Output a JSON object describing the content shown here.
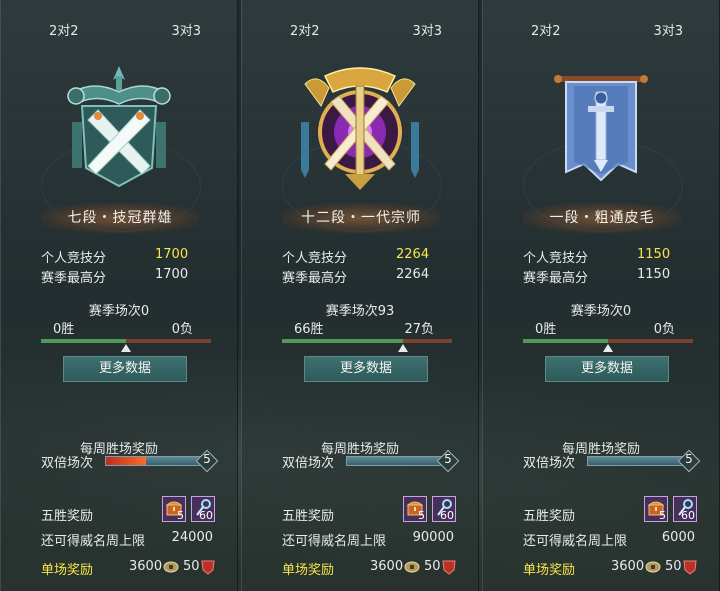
{
  "panels": [
    {
      "tabs": {
        "left": "2对2",
        "right": "3对3"
      },
      "emblem": "seven-duan-emblem-icon",
      "rank_title": "七段・技冠群雄",
      "personal_label": "个人竞技分",
      "personal_score": "1700",
      "season_high_label": "赛季最高分",
      "season_high": "1700",
      "season_matches": "赛季场次0",
      "wins": "0胜",
      "losses": "0负",
      "win_ratio": 0.5,
      "more_button": "更多数据",
      "weekly_title": "每周胜场奖励",
      "double_label": "双倍场次",
      "double_max": "5",
      "double_progress": 0.4,
      "five_win_label": "五胜奖励",
      "reward_items": [
        {
          "icon": "treasure-chest-icon",
          "count": "5"
        },
        {
          "icon": "key-icon",
          "count": "60"
        }
      ],
      "cap_label": "还可得威名周上限",
      "cap_value": "24000",
      "single_label": "单场奖励",
      "single_coins": "3600",
      "single_fame": "50"
    },
    {
      "tabs": {
        "left": "2对2",
        "right": "3对3"
      },
      "emblem": "twelve-duan-emblem-icon",
      "rank_title": "十二段・一代宗师",
      "personal_label": "个人竞技分",
      "personal_score": "2264",
      "season_high_label": "赛季最高分",
      "season_high": "2264",
      "season_matches": "赛季场次93",
      "wins": "66胜",
      "losses": "27负",
      "win_ratio": 0.71,
      "more_button": "更多数据",
      "weekly_title": "每周胜场奖励",
      "double_label": "双倍场次",
      "double_max": "5",
      "double_progress": 0,
      "five_win_label": "五胜奖励",
      "reward_items": [
        {
          "icon": "treasure-chest-icon",
          "count": "5"
        },
        {
          "icon": "key-icon",
          "count": "60"
        }
      ],
      "cap_label": "还可得威名周上限",
      "cap_value": "90000",
      "single_label": "单场奖励",
      "single_coins": "3600",
      "single_fame": "50"
    },
    {
      "tabs": {
        "left": "2对2",
        "right": "3对3"
      },
      "emblem": "one-duan-banner-icon",
      "rank_title": "一段・粗通皮毛",
      "personal_label": "个人竞技分",
      "personal_score": "1150",
      "season_high_label": "赛季最高分",
      "season_high": "1150",
      "season_matches": "赛季场次0",
      "wins": "0胜",
      "losses": "0负",
      "win_ratio": 0.5,
      "more_button": "更多数据",
      "weekly_title": "每周胜场奖励",
      "double_label": "双倍场次",
      "double_max": "5",
      "double_progress": 0,
      "five_win_label": "五胜奖励",
      "reward_items": [
        {
          "icon": "treasure-chest-icon",
          "count": "5"
        },
        {
          "icon": "key-icon",
          "count": "60"
        }
      ],
      "cap_label": "还可得威名周上限",
      "cap_value": "6000",
      "single_label": "单场奖励",
      "single_coins": "3600",
      "single_fame": "50"
    }
  ],
  "colors": {
    "highlight": "#f5e74a",
    "win_green": "#4f9a54",
    "loss_red": "#7a4030",
    "button": "#336464"
  }
}
